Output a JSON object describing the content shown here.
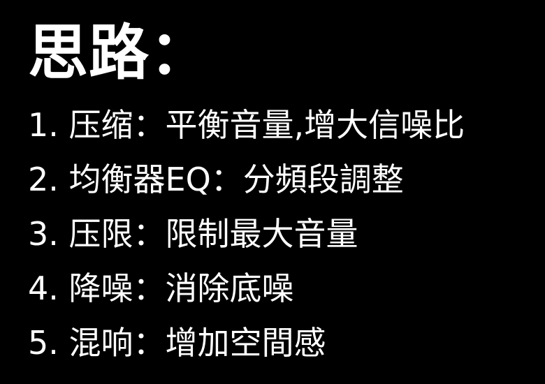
{
  "slide": {
    "title": "思路：",
    "items": [
      {
        "text": "1. 压缩：平衡音量,增大信噪比"
      },
      {
        "text": "2. 均衡器EQ：分頻段調整"
      },
      {
        "text": "3. 压限：限制最大音量"
      },
      {
        "text": "4. 降噪：消除底噪"
      },
      {
        "text": "5. 混响：增加空間感"
      }
    ]
  },
  "colors": {
    "background": "#000000",
    "text": "#ffffff"
  }
}
